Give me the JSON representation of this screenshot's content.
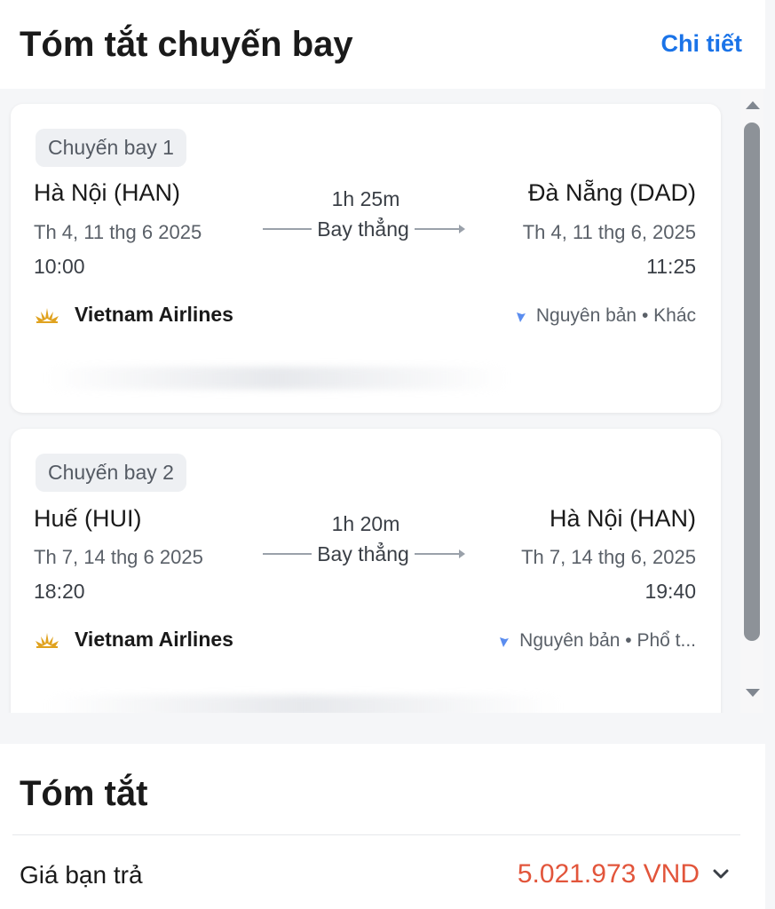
{
  "header": {
    "title": "Tóm tắt chuyến bay",
    "details_link": "Chi tiết"
  },
  "flights": [
    {
      "badge": "Chuyến bay 1",
      "origin": "Hà Nội (HAN)",
      "origin_date": "Th 4, 11 thg 6 2025",
      "origin_time": "10:00",
      "duration": "1h 25m",
      "stops": "Bay thẳng",
      "destination": "Đà Nẵng (DAD)",
      "destination_date": "Th 4, 11 thg 6, 2025",
      "destination_time": "11:25",
      "airline": "Vietnam Airlines",
      "fare": "Nguyên bản • Khác"
    },
    {
      "badge": "Chuyến bay 2",
      "origin": "Huế (HUI)",
      "origin_date": "Th 7, 14 thg 6 2025",
      "origin_time": "18:20",
      "duration": "1h 20m",
      "stops": "Bay thẳng",
      "destination": "Hà Nội (HAN)",
      "destination_date": "Th 7, 14 thg 6, 2025",
      "destination_time": "19:40",
      "airline": "Vietnam Airlines",
      "fare": "Nguyên bản • Phổ t..."
    }
  ],
  "summary": {
    "title": "Tóm tắt",
    "price_label": "Giá bạn trả",
    "price_value": "5.021.973 VND"
  },
  "colors": {
    "accent_link": "#1a73e8",
    "price": "#e2553b",
    "airline_logo": "#e0a21f"
  },
  "icons": {
    "airline_logo": "vietnam-airlines-lotus-icon",
    "fare": "fare-tag-icon",
    "chevron": "chevron-down-icon"
  }
}
